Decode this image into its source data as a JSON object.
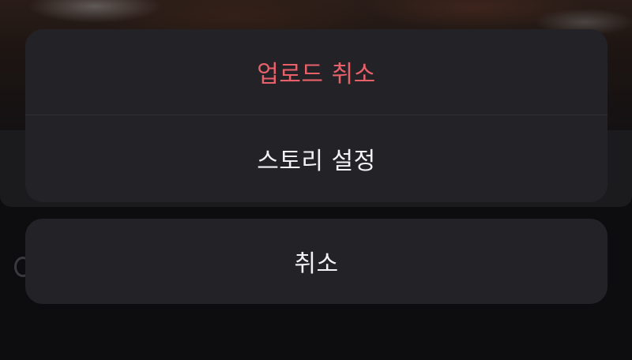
{
  "action_sheet": {
    "cancel_upload_label": "업로드 취소",
    "story_settings_label": "스토리 설정",
    "cancel_label": "취소"
  },
  "colors": {
    "destructive": "#e8606a",
    "sheet_background": "#232327",
    "text": "#f2f2f4"
  }
}
